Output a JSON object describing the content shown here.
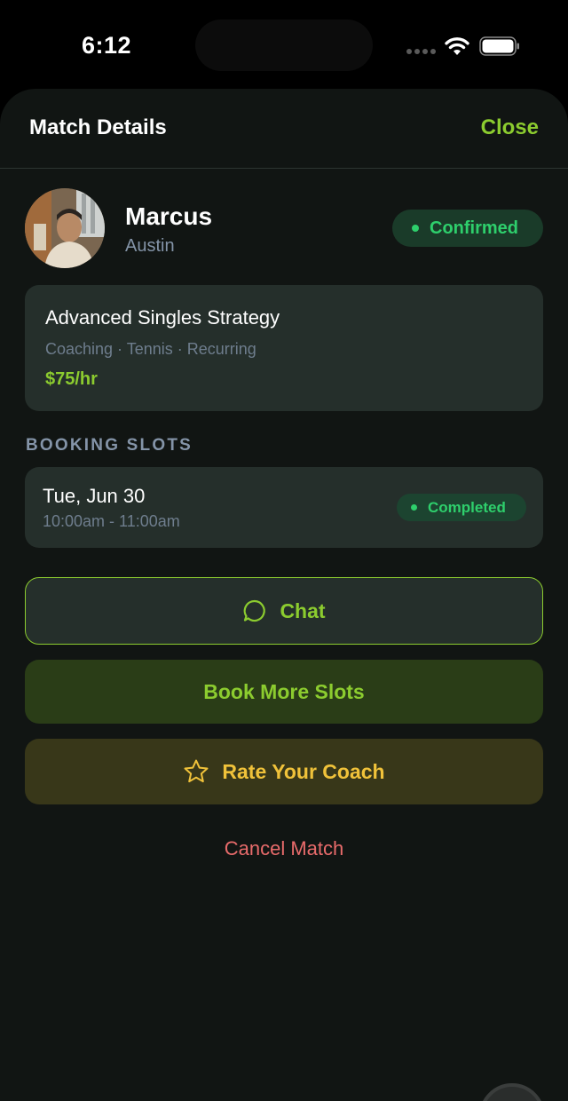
{
  "status_bar": {
    "time": "6:12"
  },
  "sheet": {
    "title": "Match Details",
    "close_label": "Close"
  },
  "coach": {
    "name": "Marcus",
    "city": "Austin",
    "status": "Confirmed"
  },
  "session": {
    "title": "Advanced Singles Strategy",
    "meta": "Coaching · Tennis · Recurring",
    "price": "$75/hr"
  },
  "booking": {
    "section_label": "BOOKING SLOTS",
    "slots": [
      {
        "date": "Tue, Jun 30",
        "time": "10:00am - 11:00am",
        "status": "Completed"
      }
    ]
  },
  "actions": {
    "chat_label": "Chat",
    "book_more_label": "Book More Slots",
    "rate_label": "Rate Your Coach",
    "cancel_label": "Cancel Match"
  },
  "colors": {
    "accent_green": "#8ccc2f",
    "status_green": "#2ecf6c",
    "rate_gold": "#f0c23a",
    "cancel_red": "#e86b6b",
    "sheet_bg": "#111513",
    "card_bg": "#252f2b"
  },
  "icons": {
    "chat": "chat-bubble-icon",
    "rate": "star-outline-icon",
    "signal": "cellular-signal-icon",
    "wifi": "wifi-icon",
    "battery": "battery-icon"
  }
}
